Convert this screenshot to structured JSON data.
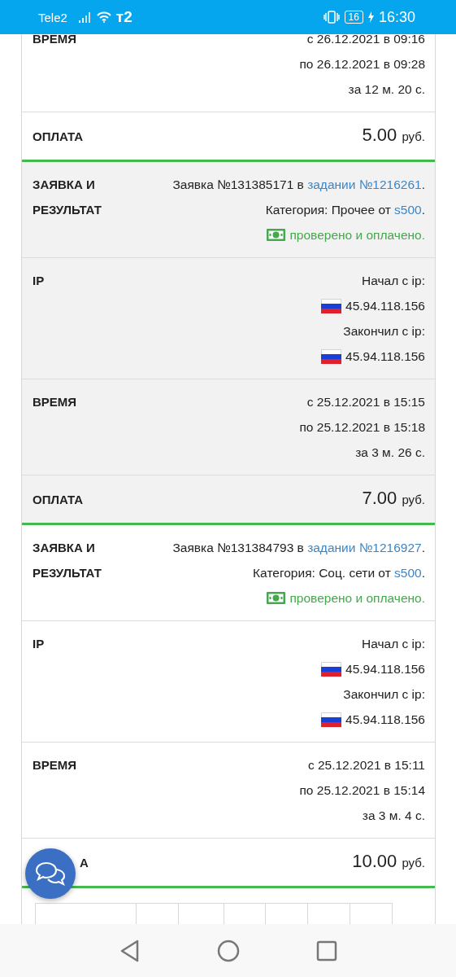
{
  "status_bar": {
    "carrier": "Tele2",
    "operator_logo": "т2",
    "battery": "16",
    "charging": true,
    "time": "16:30"
  },
  "entries": [
    {
      "shaded": false,
      "clipped_top": true,
      "rows": [
        {
          "kind": "time",
          "label": "ВРЕМЯ",
          "lines": [
            "с 26.12.2021 в 09:16",
            "по 26.12.2021 в 09:28",
            "за 12 м. 20 с."
          ]
        },
        {
          "kind": "payment",
          "label": "ОПЛАТА",
          "amount": "5.00",
          "currency": "руб."
        }
      ]
    },
    {
      "shaded": true,
      "clipped_top": false,
      "rows": [
        {
          "kind": "request",
          "label": "ЗАЯВКА И РЕЗУЛЬТАТ",
          "request": {
            "prefix": "Заявка №131385171 в ",
            "link": "задании №1216261",
            "suffix": "."
          },
          "category": {
            "prefix": "Категория: Прочее от ",
            "link": "s500",
            "suffix": "."
          },
          "status": "проверено и оплачено."
        },
        {
          "kind": "ip",
          "label": "IP",
          "start_label": "Начал с ip:",
          "start_ip": "45.94.118.156",
          "end_label": "Закончил с ip:",
          "end_ip": "45.94.118.156"
        },
        {
          "kind": "time",
          "label": "ВРЕМЯ",
          "lines": [
            "с 25.12.2021 в 15:15",
            "по 25.12.2021 в 15:18",
            "за 3 м. 26 с."
          ]
        },
        {
          "kind": "payment",
          "label": "ОПЛАТА",
          "amount": "7.00",
          "currency": "руб."
        }
      ]
    },
    {
      "shaded": false,
      "clipped_top": false,
      "rows": [
        {
          "kind": "request",
          "label": "ЗАЯВКА И РЕЗУЛЬТАТ",
          "request": {
            "prefix": "Заявка №131384793 в ",
            "link": "задании №1216927",
            "suffix": "."
          },
          "category": {
            "prefix": "Категория: Соц. сети от ",
            "link": "s500",
            "suffix": "."
          },
          "status": "проверено и оплачено."
        },
        {
          "kind": "ip",
          "label": "IP",
          "start_label": "Начал с ip:",
          "start_ip": "45.94.118.156",
          "end_label": "Закончил с ip:",
          "end_ip": "45.94.118.156"
        },
        {
          "kind": "time",
          "label": "ВРЕМЯ",
          "lines": [
            "с 25.12.2021 в 15:11",
            "по 25.12.2021 в 15:14",
            "за 3 м. 4 с."
          ]
        },
        {
          "kind": "payment",
          "label": "А",
          "covered": true,
          "amount": "10.00",
          "currency": "руб."
        }
      ]
    }
  ]
}
